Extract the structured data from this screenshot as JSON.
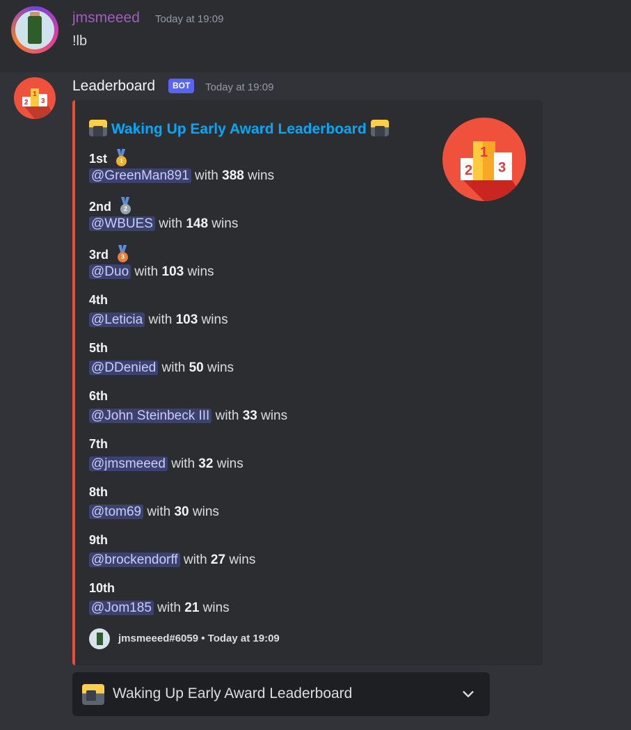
{
  "message1": {
    "username": "jmsmeeed",
    "timestamp": "Today at 19:09",
    "content": "!lb"
  },
  "message2": {
    "username": "Leaderboard",
    "badge": "BOT",
    "timestamp": "Today at 19:09"
  },
  "embed": {
    "title": "Waking Up Early Award Leaderboard",
    "entries": [
      {
        "rank": "1st",
        "medal": "gold-medal",
        "user": "@GreenMan891",
        "with": " with ",
        "wins": "388",
        "suffix": " wins"
      },
      {
        "rank": "2nd",
        "medal": "silver-medal",
        "user": "@WBUES",
        "with": " with ",
        "wins": "148",
        "suffix": " wins"
      },
      {
        "rank": "3rd",
        "medal": "bronze-medal",
        "user": "@Duo",
        "with": " with ",
        "wins": "103",
        "suffix": " wins"
      },
      {
        "rank": "4th",
        "user": "@Leticia",
        "with": " with ",
        "wins": "103",
        "suffix": " wins"
      },
      {
        "rank": "5th",
        "user": "@DDenied",
        "with": " with ",
        "wins": "50",
        "suffix": " wins"
      },
      {
        "rank": "6th",
        "user": "@John Steinbeck III",
        "with": " with ",
        "wins": "33",
        "suffix": " wins"
      },
      {
        "rank": "7th",
        "user": "@jmsmeeed",
        "with": " with ",
        "wins": "32",
        "suffix": " wins"
      },
      {
        "rank": "8th",
        "user": "@tom69",
        "with": " with ",
        "wins": "30",
        "suffix": " wins"
      },
      {
        "rank": "9th",
        "user": "@brockendorff",
        "with": " with ",
        "wins": "27",
        "suffix": " wins"
      },
      {
        "rank": "10th",
        "user": "@Jom185",
        "with": " with ",
        "wins": "21",
        "suffix": " wins"
      }
    ],
    "footer": "jmsmeeed#6059 • Today at 19:09",
    "accent_color": "#f04a35"
  },
  "select_menu": {
    "label": "Waking Up Early Award Leaderboard",
    "icon": "chevron-down-icon"
  },
  "colors": {
    "mention_bg": "#3c4270",
    "link_title": "#00a8fc",
    "bot_badge": "#5865f2"
  }
}
